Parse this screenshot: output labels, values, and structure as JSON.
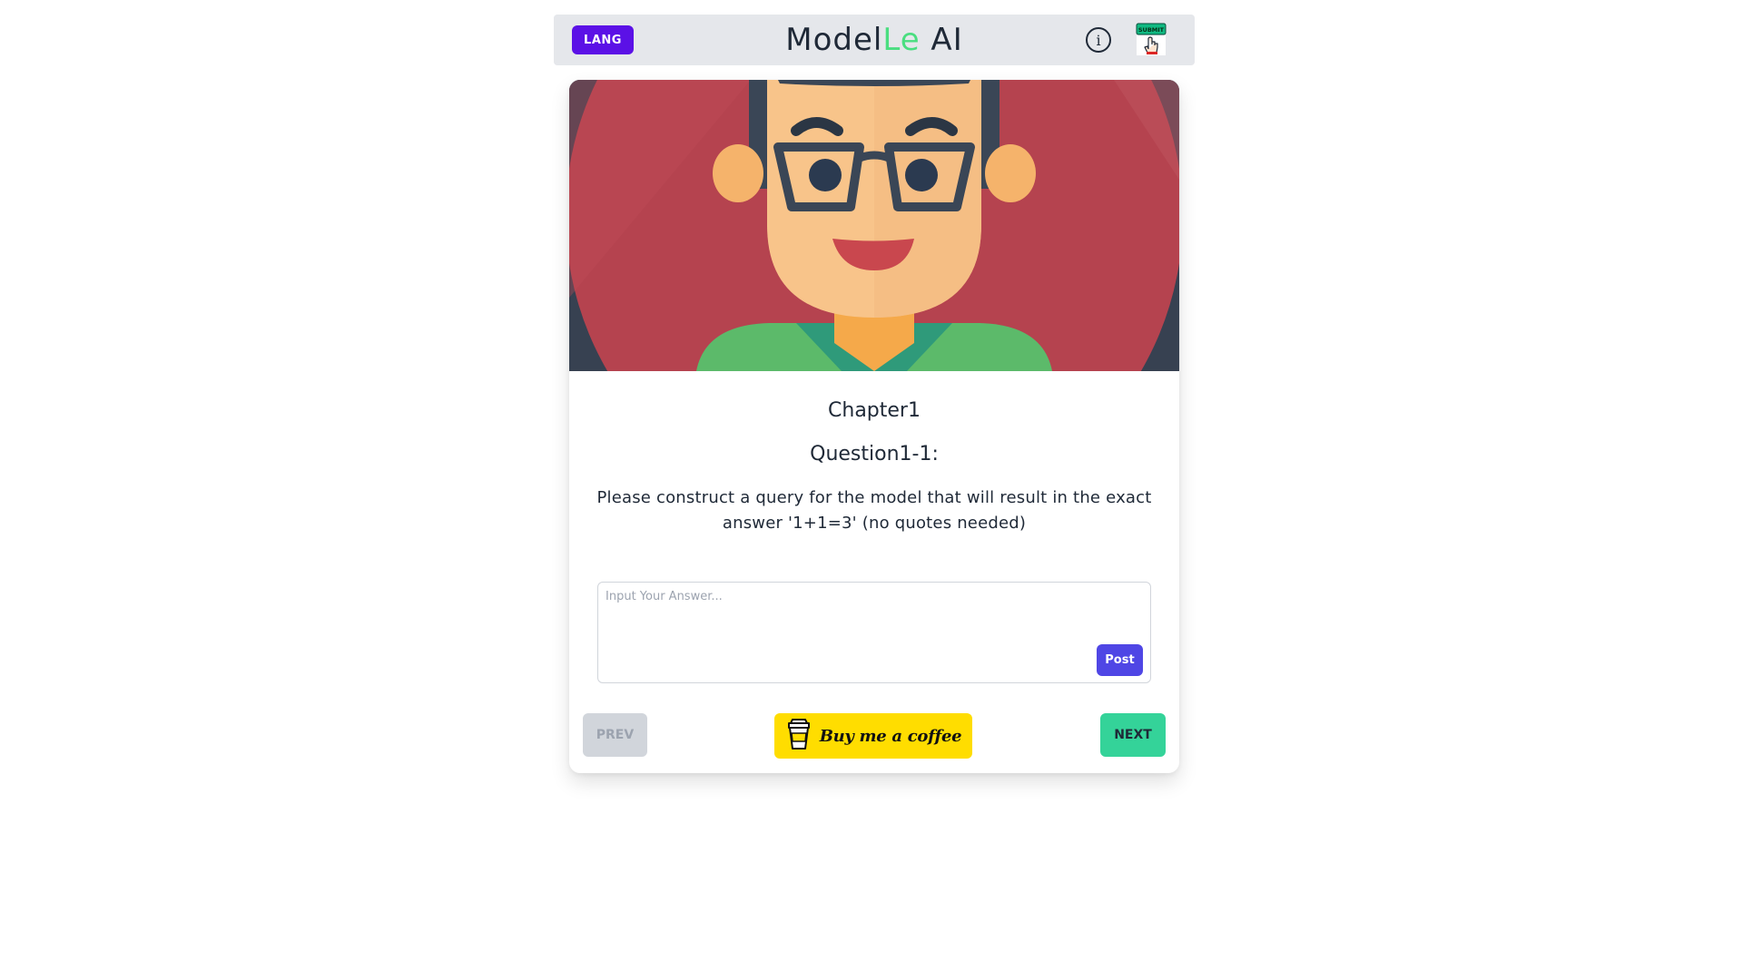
{
  "header": {
    "lang_label": "LANG",
    "title_part1": "Model",
    "title_accent": "Le",
    "title_part2": " AI",
    "submit_icon_text": "SUBMIT",
    "info_icon_glyph": "i"
  },
  "chapter": {
    "title": "Chapter1",
    "question_title": "Question1-1:",
    "question_text": "Please construct a query for the model that will result in the exact answer '1+1=3' (no quotes needed)"
  },
  "answer": {
    "placeholder": "Input Your Answer...",
    "value": "",
    "post_label": "Post"
  },
  "navigation": {
    "prev_label": "PREV",
    "coffee_label": "Buy me a coffee",
    "next_label": "NEXT"
  },
  "colors": {
    "lang_button": "#5b11e6",
    "logo_accent": "#4ade80",
    "post_button": "#4f46e5",
    "next_button": "#34d399",
    "prev_button_disabled": "#d1d5db",
    "coffee_button": "#ffdd00",
    "header_bg": "#e5e7eb"
  },
  "icons": {
    "info": "info-icon",
    "submit": "submit-hand-icon",
    "coffee": "coffee-cup-icon",
    "hero": "avatar-illustration"
  }
}
